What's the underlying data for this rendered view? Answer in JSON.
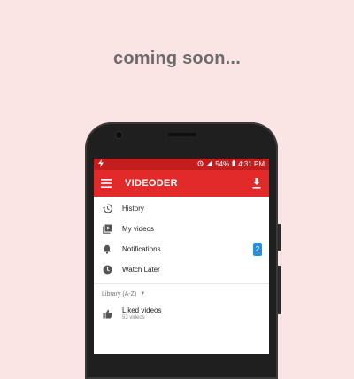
{
  "headline": "coming soon...",
  "status_bar": {
    "battery": "54%",
    "time": "4:31 PM"
  },
  "app_bar": {
    "title": "VIDEODER",
    "menu_icon": "hamburger-menu-icon",
    "download_icon": "download-icon"
  },
  "menu": {
    "items": [
      {
        "label": "History",
        "icon": "history-icon"
      },
      {
        "label": "My videos",
        "icon": "video-library-icon"
      },
      {
        "label": "Notifications",
        "icon": "bell-icon",
        "badge": "2"
      },
      {
        "label": "Watch Later",
        "icon": "clock-icon"
      }
    ]
  },
  "library": {
    "header": "Library (A-Z)",
    "items": [
      {
        "title": "Liked videos",
        "subtitle": "53 videos",
        "icon": "thumbs-up-icon"
      }
    ]
  },
  "colors": {
    "background": "#fbe5e4",
    "status_bar": "#c41d1d",
    "app_bar": "#e32a2a",
    "badge": "#2a8fe0"
  }
}
